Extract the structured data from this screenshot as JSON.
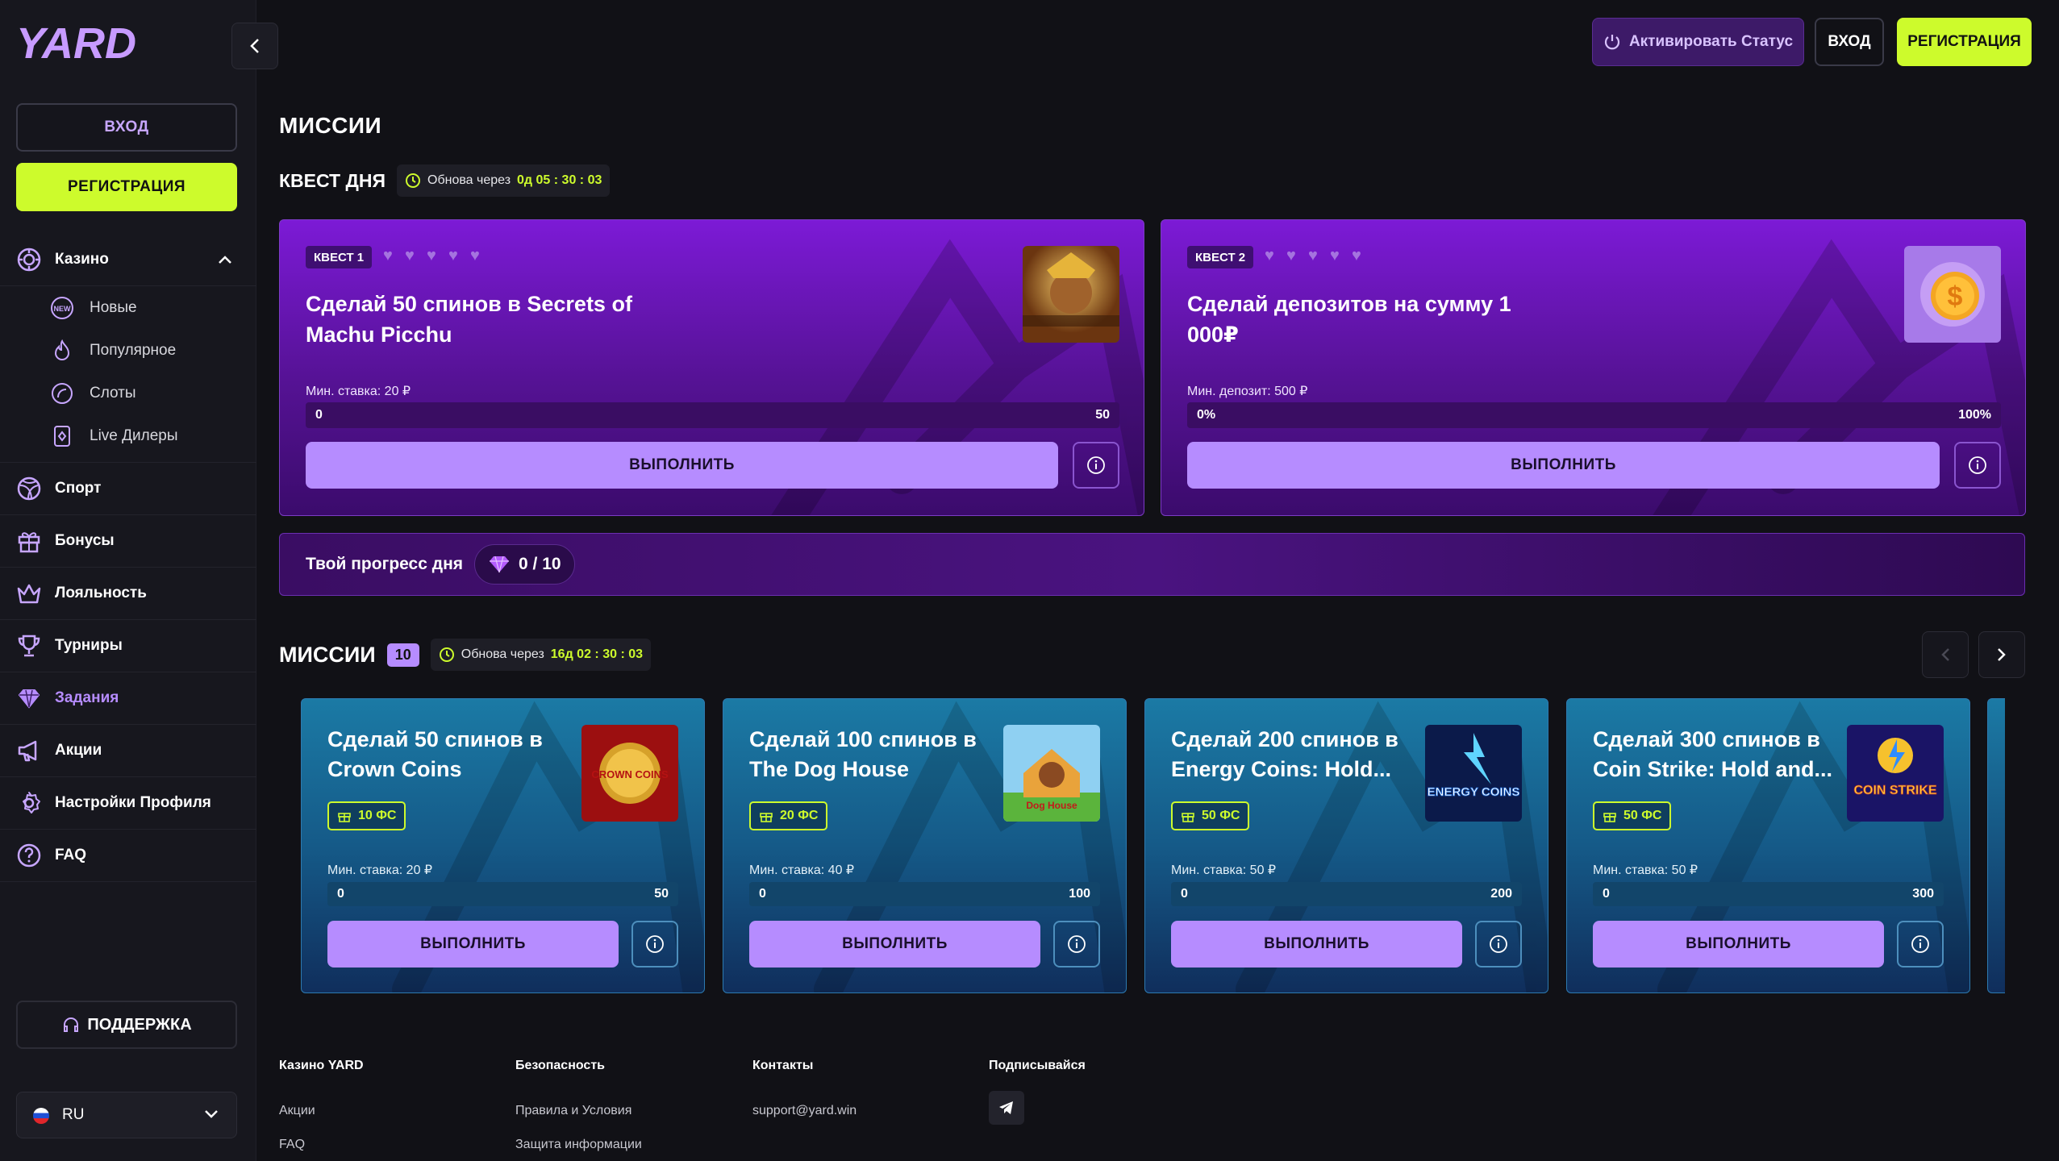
{
  "brand": {
    "logo": "YARD",
    "accent": "#cdfb2c",
    "purple": "#b68cff"
  },
  "header": {
    "activate_status": "Активировать Статус",
    "login": "ВХОД",
    "register": "РЕГИСТРАЦИЯ"
  },
  "sidebar": {
    "login": "ВХОД",
    "register": "РЕГИСТРАЦИЯ",
    "casino": {
      "label": "Казино",
      "subitems": [
        "Новые",
        "Популярное",
        "Слоты",
        "Live Дилеры"
      ]
    },
    "items": [
      "Спорт",
      "Бонусы",
      "Лояльность",
      "Турниры",
      "Задания",
      "Акции",
      "Настройки Профиля",
      "FAQ"
    ],
    "support": "ПОДДЕРЖКА",
    "language": "RU"
  },
  "main": {
    "title": "МИССИИ",
    "quest_of_day": {
      "title": "КВЕСТ ДНЯ",
      "timer_label": "Обнова через",
      "timer_value": "0д 05 : 30 : 03",
      "quests": [
        {
          "badge": "КВЕСТ 1",
          "title": "Сделай 50 спинов в Secrets of Machu Picchu",
          "min_label": "Мин. ставка: 20 ₽",
          "bar_left": "0",
          "bar_right": "50",
          "action": "ВЫПОЛНИТЬ",
          "hearts": 5,
          "progress": 0
        },
        {
          "badge": "КВЕСТ 2",
          "title": "Сделай депозитов на сумму 1 000₽",
          "min_label": "Мин. депозит: 500 ₽",
          "bar_left": "0%",
          "bar_right": "100%",
          "action": "ВЫПОЛНИТЬ",
          "hearts": 5,
          "progress": 0
        }
      ]
    },
    "daily_progress": {
      "label": "Твой прогресс дня",
      "value": "0 / 10"
    },
    "missions": {
      "title": "МИССИИ",
      "count": "10",
      "timer_label": "Обнова через",
      "timer_value": "16д 02 : 30 : 03",
      "cards": [
        {
          "title": "Сделай 50 спинов в Crown Coins",
          "reward": "10 ФС",
          "min_label": "Мин. ставка: 20 ₽",
          "bar_left": "0",
          "bar_right": "50",
          "action": "ВЫПОЛНИТЬ",
          "thumb_text": "CROWN COINS"
        },
        {
          "title": "Сделай 100 спинов в The Dog House",
          "reward": "20 ФС",
          "min_label": "Мин. ставка: 40 ₽",
          "bar_left": "0",
          "bar_right": "100",
          "action": "ВЫПОЛНИТЬ",
          "thumb_text": "Dog House"
        },
        {
          "title": "Сделай 200 спинов в Energy Coins: Hold...",
          "reward": "50 ФС",
          "min_label": "Мин. ставка: 50 ₽",
          "bar_left": "0",
          "bar_right": "200",
          "action": "ВЫПОЛНИТЬ",
          "thumb_text": "ENERGY COINS"
        },
        {
          "title": "Сделай 300 спинов в Coin Strike: Hold and...",
          "reward": "50 ФС",
          "min_label": "Мин. ставка: 50 ₽",
          "bar_left": "0",
          "bar_right": "300",
          "action": "ВЫПОЛНИТЬ",
          "thumb_text": "COIN STRIKE"
        }
      ]
    }
  },
  "footer": {
    "col1": {
      "head": "Казино YARD",
      "links": [
        "Акции",
        "FAQ"
      ]
    },
    "col2": {
      "head": "Безопасность",
      "links": [
        "Правила и Условия",
        "Защита информации"
      ]
    },
    "col3": {
      "head": "Контакты",
      "links": [
        "support@yard.win"
      ]
    },
    "col4": {
      "head": "Подписывайся"
    }
  }
}
